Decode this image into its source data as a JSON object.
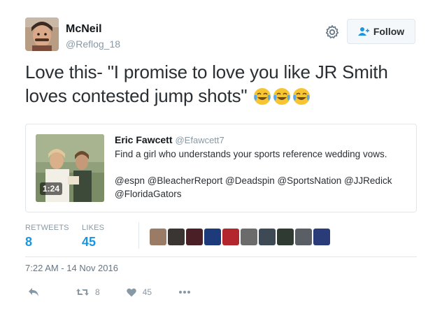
{
  "author": {
    "name": "McNeil",
    "handle": "@Reflog_18",
    "follow_label": "Follow"
  },
  "tweet": {
    "text": "Love this- \"I promise to love you like JR Smith loves contested jump shots\"",
    "emojis": [
      "face-with-tears-of-joy",
      "face-with-tears-of-joy",
      "face-with-tears-of-joy"
    ]
  },
  "quoted": {
    "name": "Eric Fawcett",
    "handle": "@Efawcett7",
    "line1": "Find a girl who understands your sports reference wedding vows.",
    "line2": "@espn @BleacherReport @Deadspin @SportsNation @JJRedick",
    "line3": "@FloridaGators",
    "video_duration": "1:24"
  },
  "stats": {
    "retweets_label": "RETWEETS",
    "retweets_value": "8",
    "likes_label": "LIKES",
    "likes_value": "45"
  },
  "likers": [
    {
      "color": "#9a7b66"
    },
    {
      "color": "#3a3433"
    },
    {
      "color": "#4a1f25"
    },
    {
      "color": "#1d3a7a"
    },
    {
      "color": "#b3262e"
    },
    {
      "color": "#6b6b6b"
    },
    {
      "color": "#3d4a55"
    },
    {
      "color": "#2f3a33"
    },
    {
      "color": "#5a5f66"
    },
    {
      "color": "#2a3b7a"
    }
  ],
  "timestamp": "7:22 AM - 14 Nov 2016",
  "actions": {
    "retweet_count": "8",
    "like_count": "45"
  },
  "colors": {
    "link_blue": "#1b95e0",
    "muted": "#8899a6",
    "border": "#e1e8ed"
  }
}
